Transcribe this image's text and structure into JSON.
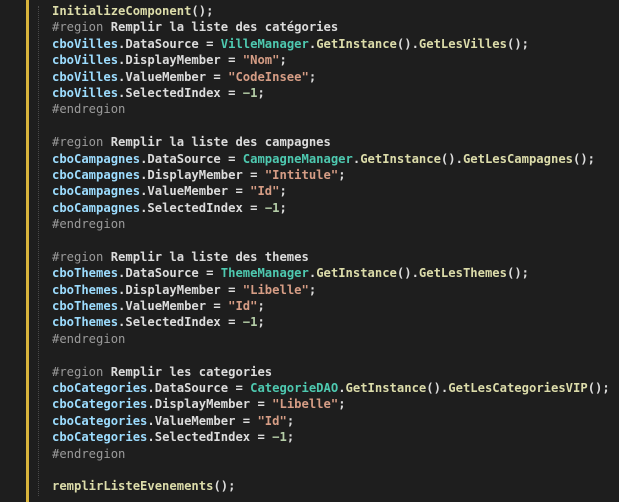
{
  "colors": {
    "background": "#1e1e1e",
    "method": "#dcdcaa",
    "region": "#9b9b9b",
    "variable": "#9cdcfe",
    "type": "#4ec9b0",
    "string": "#d69d85",
    "number": "#b5cea8",
    "plain": "#dcdcdc",
    "gutter_marker": "#d9b43c"
  },
  "lines": [
    [
      {
        "t": "InitializeComponent",
        "c": "method"
      },
      {
        "t": "();",
        "c": "punct"
      }
    ],
    [
      {
        "t": "#region ",
        "c": "region"
      },
      {
        "t": "Remplir la liste des catégories",
        "c": "region-title"
      }
    ],
    [
      {
        "t": "cboVilles",
        "c": "var"
      },
      {
        "t": ".DataSource = ",
        "c": "punct"
      },
      {
        "t": "VilleManager",
        "c": "type"
      },
      {
        "t": ".",
        "c": "punct"
      },
      {
        "t": "GetInstance",
        "c": "method"
      },
      {
        "t": "().",
        "c": "punct"
      },
      {
        "t": "GetLesVilles",
        "c": "method"
      },
      {
        "t": "();",
        "c": "punct"
      }
    ],
    [
      {
        "t": "cboVilles",
        "c": "var"
      },
      {
        "t": ".DisplayMember = ",
        "c": "punct"
      },
      {
        "t": "\"Nom\"",
        "c": "string"
      },
      {
        "t": ";",
        "c": "punct"
      }
    ],
    [
      {
        "t": "cboVilles",
        "c": "var"
      },
      {
        "t": ".ValueMember = ",
        "c": "punct"
      },
      {
        "t": "\"CodeInsee\"",
        "c": "string"
      },
      {
        "t": ";",
        "c": "punct"
      }
    ],
    [
      {
        "t": "cboVilles",
        "c": "var"
      },
      {
        "t": ".SelectedIndex = ",
        "c": "punct"
      },
      {
        "t": "−1",
        "c": "number"
      },
      {
        "t": ";",
        "c": "punct"
      }
    ],
    [
      {
        "t": "#endregion",
        "c": "region"
      }
    ],
    [],
    [
      {
        "t": "#region ",
        "c": "region"
      },
      {
        "t": "Remplir la liste des campagnes",
        "c": "region-title"
      }
    ],
    [
      {
        "t": "cboCampagnes",
        "c": "var"
      },
      {
        "t": ".DataSource = ",
        "c": "punct"
      },
      {
        "t": "CampagneManager",
        "c": "type"
      },
      {
        "t": ".",
        "c": "punct"
      },
      {
        "t": "GetInstance",
        "c": "method"
      },
      {
        "t": "().",
        "c": "punct"
      },
      {
        "t": "GetLesCampagnes",
        "c": "method"
      },
      {
        "t": "();",
        "c": "punct"
      }
    ],
    [
      {
        "t": "cboCampagnes",
        "c": "var"
      },
      {
        "t": ".DisplayMember = ",
        "c": "punct"
      },
      {
        "t": "\"Intitule\"",
        "c": "string"
      },
      {
        "t": ";",
        "c": "punct"
      }
    ],
    [
      {
        "t": "cboCampagnes",
        "c": "var"
      },
      {
        "t": ".ValueMember = ",
        "c": "punct"
      },
      {
        "t": "\"Id\"",
        "c": "string"
      },
      {
        "t": ";",
        "c": "punct"
      }
    ],
    [
      {
        "t": "cboCampagnes",
        "c": "var"
      },
      {
        "t": ".SelectedIndex = ",
        "c": "punct"
      },
      {
        "t": "−1",
        "c": "number"
      },
      {
        "t": ";",
        "c": "punct"
      }
    ],
    [
      {
        "t": "#endregion",
        "c": "region"
      }
    ],
    [],
    [
      {
        "t": "#region ",
        "c": "region"
      },
      {
        "t": "Remplir la liste des themes",
        "c": "region-title"
      }
    ],
    [
      {
        "t": "cboThemes",
        "c": "var"
      },
      {
        "t": ".DataSource = ",
        "c": "punct"
      },
      {
        "t": "ThemeManager",
        "c": "type"
      },
      {
        "t": ".",
        "c": "punct"
      },
      {
        "t": "GetInstance",
        "c": "method"
      },
      {
        "t": "().",
        "c": "punct"
      },
      {
        "t": "GetLesThemes",
        "c": "method"
      },
      {
        "t": "();",
        "c": "punct"
      }
    ],
    [
      {
        "t": "cboThemes",
        "c": "var"
      },
      {
        "t": ".DisplayMember = ",
        "c": "punct"
      },
      {
        "t": "\"Libelle\"",
        "c": "string"
      },
      {
        "t": ";",
        "c": "punct"
      }
    ],
    [
      {
        "t": "cboThemes",
        "c": "var"
      },
      {
        "t": ".ValueMember = ",
        "c": "punct"
      },
      {
        "t": "\"Id\"",
        "c": "string"
      },
      {
        "t": ";",
        "c": "punct"
      }
    ],
    [
      {
        "t": "cboThemes",
        "c": "var"
      },
      {
        "t": ".SelectedIndex = ",
        "c": "punct"
      },
      {
        "t": "−1",
        "c": "number"
      },
      {
        "t": ";",
        "c": "punct"
      }
    ],
    [
      {
        "t": "#endregion",
        "c": "region"
      }
    ],
    [],
    [
      {
        "t": "#region ",
        "c": "region"
      },
      {
        "t": "Remplir les categories",
        "c": "region-title"
      }
    ],
    [
      {
        "t": "cboCategories",
        "c": "var"
      },
      {
        "t": ".DataSource = ",
        "c": "punct"
      },
      {
        "t": "CategorieDAO",
        "c": "type"
      },
      {
        "t": ".",
        "c": "punct"
      },
      {
        "t": "GetInstance",
        "c": "method"
      },
      {
        "t": "().",
        "c": "punct"
      },
      {
        "t": "GetLesCategoriesVIP",
        "c": "method"
      },
      {
        "t": "();",
        "c": "punct"
      }
    ],
    [
      {
        "t": "cboCategories",
        "c": "var"
      },
      {
        "t": ".DisplayMember = ",
        "c": "punct"
      },
      {
        "t": "\"Libelle\"",
        "c": "string"
      },
      {
        "t": ";",
        "c": "punct"
      }
    ],
    [
      {
        "t": "cboCategories",
        "c": "var"
      },
      {
        "t": ".ValueMember = ",
        "c": "punct"
      },
      {
        "t": "\"Id\"",
        "c": "string"
      },
      {
        "t": ";",
        "c": "punct"
      }
    ],
    [
      {
        "t": "cboCategories",
        "c": "var"
      },
      {
        "t": ".SelectedIndex = ",
        "c": "punct"
      },
      {
        "t": "−1",
        "c": "number"
      },
      {
        "t": ";",
        "c": "punct"
      }
    ],
    [
      {
        "t": "#endregion",
        "c": "region"
      }
    ],
    [],
    [
      {
        "t": "remplirListeEvenements",
        "c": "method"
      },
      {
        "t": "();",
        "c": "punct"
      }
    ]
  ]
}
